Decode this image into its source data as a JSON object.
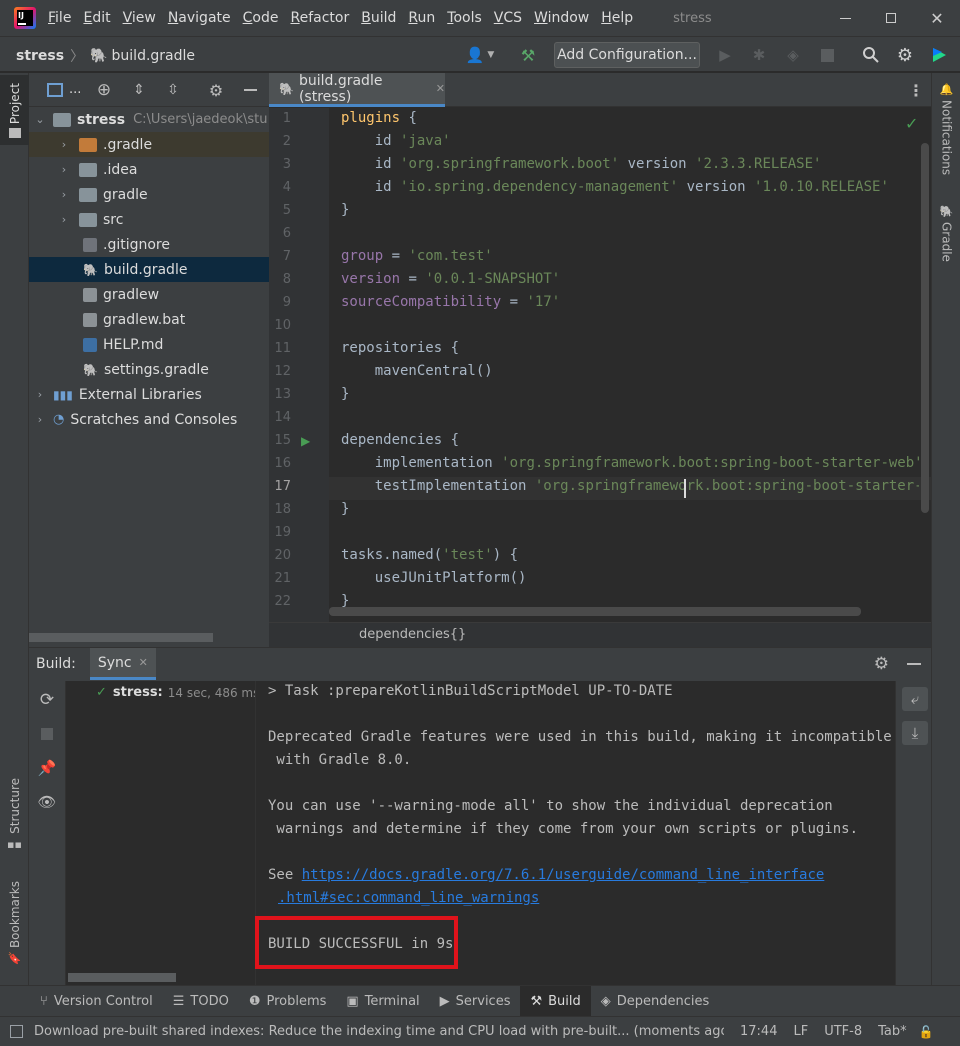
{
  "menubar": {
    "items": [
      "File",
      "Edit",
      "View",
      "Navigate",
      "Code",
      "Refactor",
      "Build",
      "Run",
      "Tools",
      "VCS",
      "Window",
      "Help"
    ],
    "project_title": "stress"
  },
  "toolbar": {
    "breadcrumb_project": "stress",
    "breadcrumb_file": "build.gradle",
    "config_label": "Add Configuration..."
  },
  "side_strips": {
    "project": "Project",
    "structure": "Structure",
    "bookmarks": "Bookmarks",
    "notifications": "Notifications",
    "gradle": "Gradle"
  },
  "project_panel": {
    "view_label": "...",
    "root_name": "stress",
    "root_path": "C:\\Users\\jaedeok\\stu",
    "items": [
      {
        "label": ".gradle",
        "type": "folder-orange",
        "expandable": true
      },
      {
        "label": ".idea",
        "type": "folder",
        "expandable": true
      },
      {
        "label": "gradle",
        "type": "folder",
        "expandable": true
      },
      {
        "label": "src",
        "type": "folder",
        "expandable": true
      },
      {
        "label": ".gitignore",
        "type": "file-ignore",
        "expandable": false
      },
      {
        "label": "build.gradle",
        "type": "file-gradle",
        "expandable": false
      },
      {
        "label": "gradlew",
        "type": "file-shell",
        "expandable": false
      },
      {
        "label": "gradlew.bat",
        "type": "file-bat",
        "expandable": false
      },
      {
        "label": "HELP.md",
        "type": "file-md",
        "expandable": false
      },
      {
        "label": "settings.gradle",
        "type": "file-gradle",
        "expandable": false
      }
    ],
    "external_libraries": "External Libraries",
    "scratches": "Scratches and Consoles"
  },
  "editor": {
    "tab_label": "build.gradle (stress)",
    "line_numbers": [
      "1",
      "2",
      "3",
      "4",
      "5",
      "6",
      "7",
      "8",
      "9",
      "10",
      "11",
      "12",
      "13",
      "14",
      "15",
      "16",
      "17",
      "18",
      "19",
      "20",
      "21",
      "22"
    ],
    "breadcrumb": "dependencies{}"
  },
  "build_panel": {
    "label": "Build:",
    "tab": "Sync",
    "tree_name": "stress:",
    "tree_time": "14 sec, 486 ms",
    "console_lines": [
      "> Task :prepareKotlinBuildScriptModel UP-TO-DATE",
      "",
      "Deprecated Gradle features were used in this build, making it incompatible",
      " with Gradle 8.0.",
      "",
      "You can use '--warning-mode all' to show the individual deprecation",
      " warnings and determine if they come from your own scripts or plugins.",
      ""
    ],
    "see_label": "See ",
    "link_line1": "https://docs.gradle.org/7.6.1/userguide/command_line_interface",
    "link_line2": ".html#sec:command_line_warnings",
    "success_line": "BUILD SUCCESSFUL in 9s"
  },
  "bottom_tabs": [
    "Version Control",
    "TODO",
    "Problems",
    "Terminal",
    "Services",
    "Build",
    "Dependencies"
  ],
  "statusbar": {
    "message": "Download pre-built shared indexes: Reduce the indexing time and CPU load with pre-built... (moments ago)",
    "time": "17:44",
    "line_sep": "LF",
    "encoding": "UTF-8",
    "indent": "Tab*"
  },
  "colors": {
    "accent_red": "#e0131b",
    "link": "#287bde",
    "selection": "#0d293e"
  }
}
